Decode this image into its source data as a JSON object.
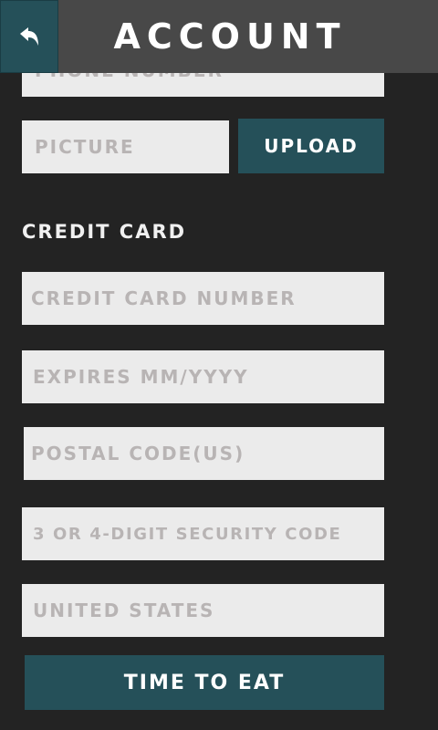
{
  "header": {
    "title": "ACCOUNT",
    "back_icon": "back-arrow-icon"
  },
  "fields": {
    "phone": "PHONE NUMBER",
    "picture": "PICTURE"
  },
  "upload_label": "UPLOAD",
  "credit_card": {
    "heading": "CREDIT CARD",
    "number": "CREDIT CARD NUMBER",
    "expires": "EXPIRES MM/YYYY",
    "postal": "POSTAL CODE(US)",
    "security": "3 OR 4-DIGIT SECURITY CODE",
    "country": "UNITED STATES"
  },
  "submit_label": "TIME TO EAT",
  "colors": {
    "accent": "#255059",
    "background": "#232323",
    "header": "#484848",
    "field": "#ebebeb",
    "placeholder": "#b8b4b4"
  }
}
